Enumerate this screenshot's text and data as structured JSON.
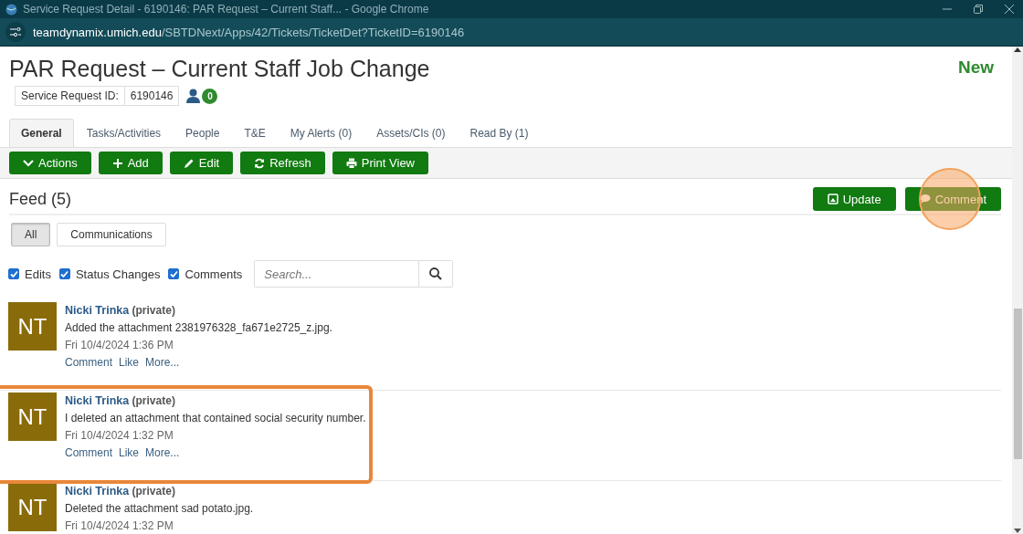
{
  "window": {
    "title": "Service Request Detail - 6190146: PAR Request – Current Staff... - Google Chrome"
  },
  "address_bar": {
    "host": "teamdynamix.umich.edu",
    "path": "/SBTDNext/Apps/42/Tickets/TicketDet?TicketID=6190146"
  },
  "ticket": {
    "title": "PAR Request – Current Staff Job Change",
    "status": "New",
    "id_label": "Service Request ID:",
    "id_value": "6190146",
    "people_count": "0"
  },
  "tabs": [
    {
      "label": "General",
      "selected": true
    },
    {
      "label": "Tasks/Activities",
      "selected": false
    },
    {
      "label": "People",
      "selected": false
    },
    {
      "label": "T&E",
      "selected": false
    },
    {
      "label": "My Alerts (0)",
      "selected": false
    },
    {
      "label": "Assets/CIs (0)",
      "selected": false
    },
    {
      "label": "Read By (1)",
      "selected": false
    }
  ],
  "toolbar": [
    {
      "kind": "caret",
      "label": "Actions"
    },
    {
      "kind": "plus",
      "label": "Add"
    },
    {
      "kind": "pencil",
      "label": "Edit"
    },
    {
      "kind": "refresh",
      "label": "Refresh"
    },
    {
      "kind": "print",
      "label": "Print View"
    }
  ],
  "feed": {
    "title": "Feed (5)",
    "actions": [
      {
        "kind": "image",
        "label": "Update",
        "clicked": false
      },
      {
        "kind": "speech",
        "label": "Comment",
        "clicked": true
      }
    ],
    "filters": [
      {
        "label": "All",
        "selected": true
      },
      {
        "label": "Communications",
        "selected": false
      }
    ],
    "checkboxes": [
      {
        "label": "Edits",
        "checked": true
      },
      {
        "label": "Status Changes",
        "checked": true
      },
      {
        "label": "Comments",
        "checked": true
      }
    ],
    "search": {
      "placeholder": "Search..."
    },
    "items": [
      {
        "initials": "NT",
        "author": "Nicki Trinka",
        "visibility": "(private)",
        "text": "Added the attachment 2381976328_fa671e2725_z.jpg.",
        "time": "Fri 10/4/2024 1:36 PM",
        "links": [
          "Comment",
          "Like",
          "More..."
        ],
        "highlighted": false
      },
      {
        "initials": "NT",
        "author": "Nicki Trinka",
        "visibility": "(private)",
        "text": "I deleted an attachment that contained social security number.",
        "time": "Fri 10/4/2024 1:32 PM",
        "links": [
          "Comment",
          "Like",
          "More..."
        ],
        "highlighted": true
      },
      {
        "initials": "NT",
        "author": "Nicki Trinka",
        "visibility": "(private)",
        "text": "Deleted the attachment sad potato.jpg.",
        "time": "Fri 10/4/2024 1:32 PM",
        "highlighted": false
      }
    ]
  }
}
